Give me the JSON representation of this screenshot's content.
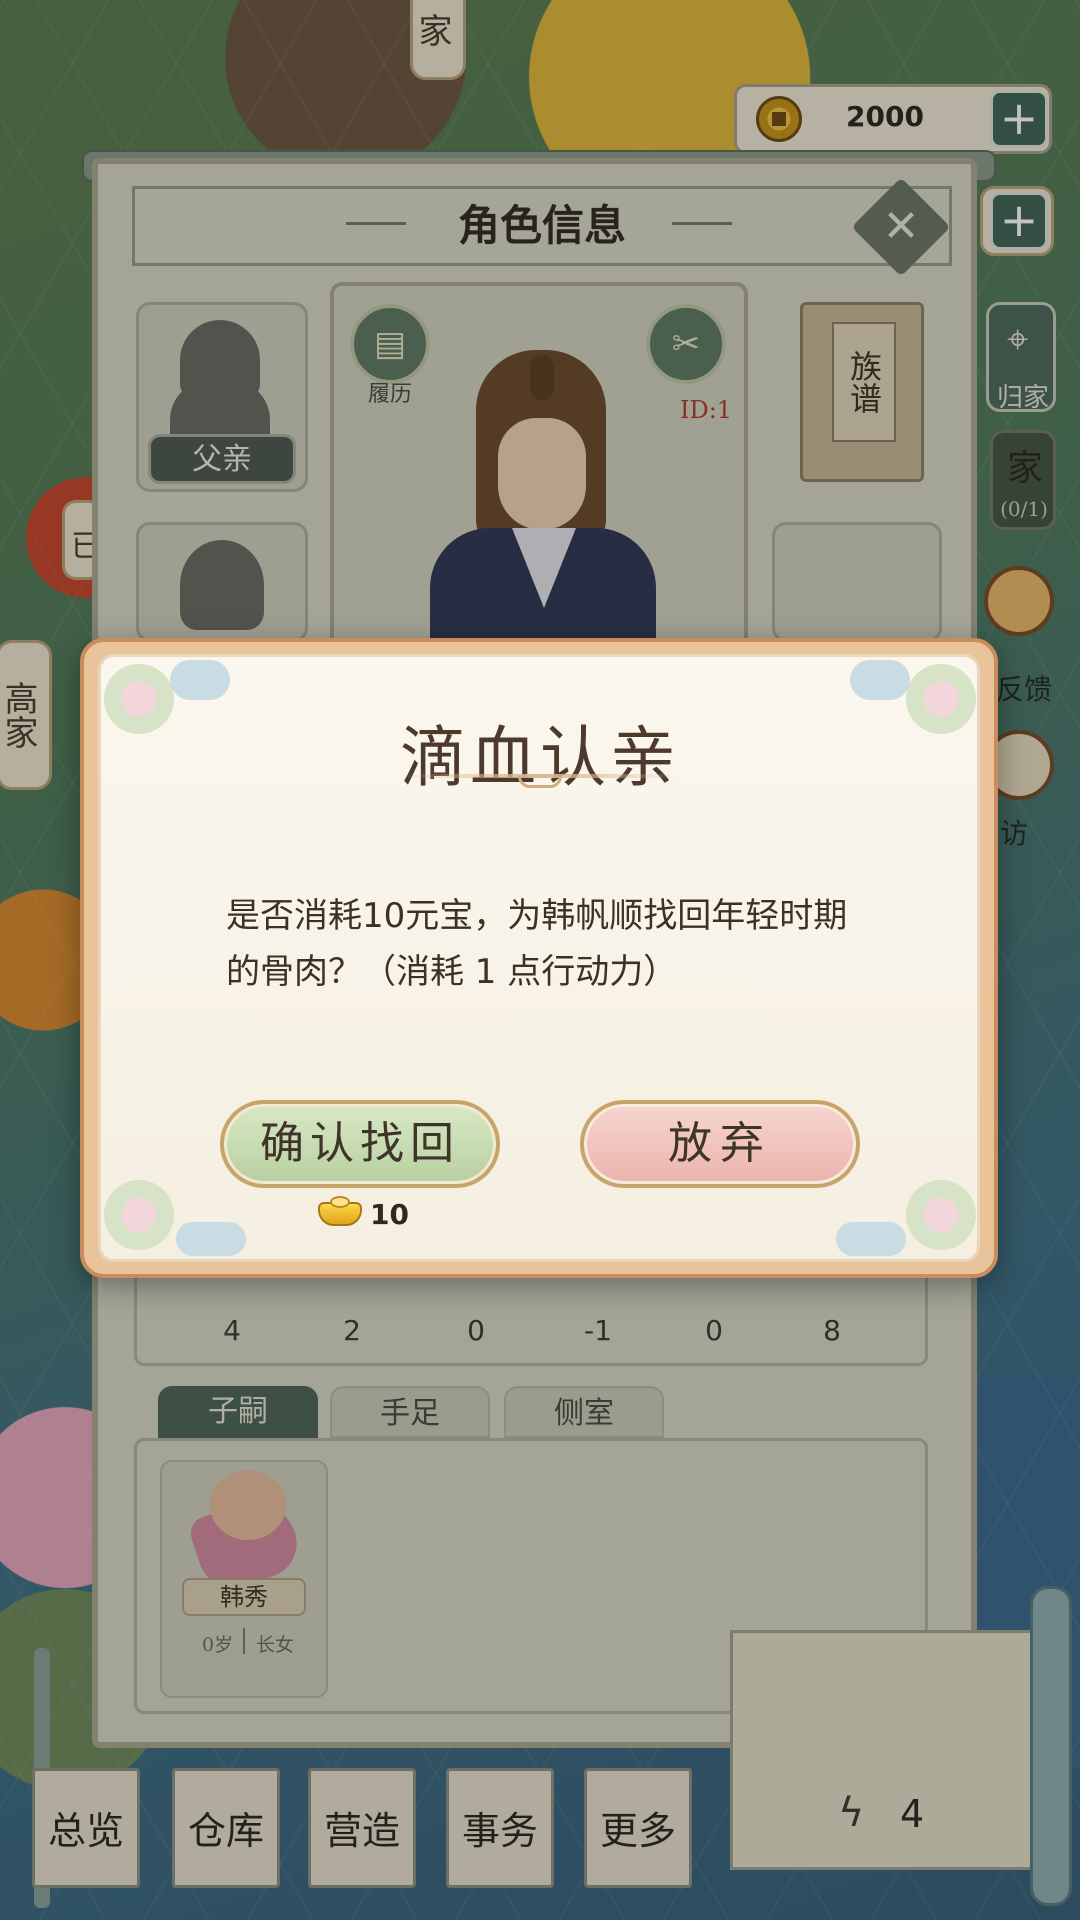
{
  "top_bar": {
    "coins": "2000",
    "plus_label": "+"
  },
  "map_labels": {
    "top_tag": "家",
    "left_tag": "高家",
    "partial_left": "已",
    "right_home": "归家",
    "right_partial": "家",
    "right_count": "(0/1)",
    "feedback": "反馈",
    "visit": "访"
  },
  "panel": {
    "title": "角色信息",
    "close_label": "✕",
    "father_label": "父亲",
    "resume_label": "履历",
    "id_label": "ID:1",
    "genealogy_label": "族谱",
    "stats": [
      "4",
      "2",
      "0",
      "-1",
      "0",
      "8"
    ],
    "tabs": [
      {
        "label": "子嗣",
        "active": true
      },
      {
        "label": "手足",
        "active": false
      },
      {
        "label": "侧室",
        "active": false
      }
    ],
    "children": [
      {
        "name": "韩秀",
        "age": "0岁",
        "rank": "长女"
      }
    ]
  },
  "dialog": {
    "title": "滴血认亲",
    "message": "是否消耗10元宝，为韩帆顺找回年轻时期的骨肉？（消耗 1 点行动力）",
    "confirm_label": "确认找回",
    "cancel_label": "放弃",
    "cost": "10",
    "cost_icon": "gold-ingot-icon"
  },
  "bottom_nav": {
    "items": [
      "总览",
      "仓库",
      "营造",
      "事务",
      "更多"
    ],
    "energy": "4",
    "energy_icon": "lightning-icon"
  },
  "colors": {
    "panel_bg": "#d7d7c7",
    "dialog_bg": "#fbf7ee",
    "confirm_bg": "#b7d0a0",
    "cancel_bg": "#eab4ac",
    "accent_green": "#4e6558"
  }
}
